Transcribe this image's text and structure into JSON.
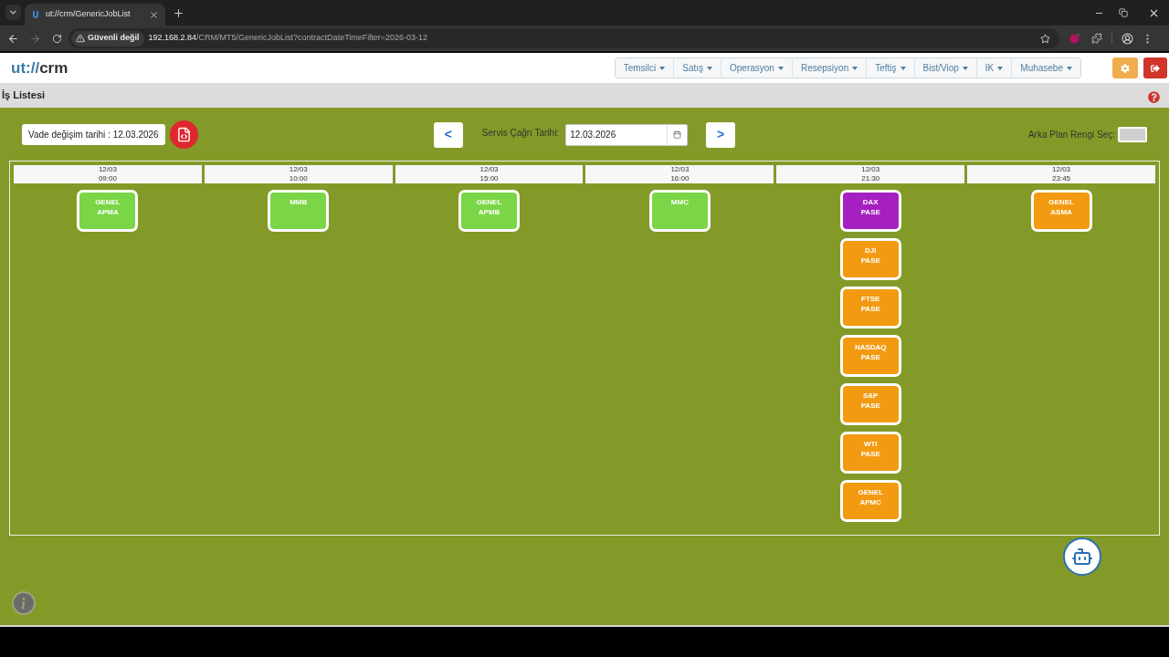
{
  "browser": {
    "tab": {
      "title": "ut://crm/GenericJobList"
    },
    "forward_button": {
      "disabled": true
    },
    "address_bar": {
      "security_label": "Güvenli değil",
      "url_host": "192.168.2.84",
      "url_path": "/CRM/MT5/GenericJobList?contractDateTimeFilter=2026-03-12"
    }
  },
  "header": {
    "logo": {
      "scheme": "ut://",
      "name": "crm"
    },
    "menu": [
      "Temsilci",
      "Satış",
      "Operasyon",
      "Resepsiyon",
      "Teftiş",
      "Bist/Viop",
      "IK",
      "Muhasebe"
    ]
  },
  "page_title": "İş Listesi",
  "toolbar": {
    "expiry_date_label": "Vade değişim tarihi : 12.03.2026",
    "prev_button": "<",
    "service_date": {
      "label": "Servis Çağrı Tarihi:",
      "value": "12.03.2026"
    },
    "next_button": ">",
    "background_picker": {
      "label": "Arka Plan Rengi Seç:"
    }
  },
  "columns": [
    {
      "date": "12/03",
      "time": "09:00",
      "jobs": [
        {
          "lines": [
            "GENEL",
            "APMA"
          ],
          "color": "#7ad646"
        }
      ]
    },
    {
      "date": "12/03",
      "time": "10:00",
      "jobs": [
        {
          "lines": [
            "MMB"
          ],
          "color": "#7ad646"
        }
      ]
    },
    {
      "date": "12/03",
      "time": "15:00",
      "jobs": [
        {
          "lines": [
            "GENEL",
            "APMB"
          ],
          "color": "#7ad646"
        }
      ]
    },
    {
      "date": "12/03",
      "time": "16:00",
      "jobs": [
        {
          "lines": [
            "MMC"
          ],
          "color": "#7ad646"
        }
      ]
    },
    {
      "date": "12/03",
      "time": "21:30",
      "jobs": [
        {
          "lines": [
            "DAX",
            "PASE"
          ],
          "color": "#a61fc0"
        },
        {
          "lines": [
            "DJI",
            "PASE"
          ],
          "color": "#f29b11"
        },
        {
          "lines": [
            "FTSE",
            "PASE"
          ],
          "color": "#f29b11"
        },
        {
          "lines": [
            "NASDAQ",
            "PASE"
          ],
          "color": "#f29b11"
        },
        {
          "lines": [
            "S&P",
            "PASE"
          ],
          "color": "#f29b11"
        },
        {
          "lines": [
            "WTI",
            "PASE"
          ],
          "color": "#f29b11"
        },
        {
          "lines": [
            "GENEL",
            "APMC"
          ],
          "color": "#f29b11"
        }
      ]
    },
    {
      "date": "12/03",
      "time": "23:45",
      "jobs": [
        {
          "lines": [
            "GENEL",
            "ASMA"
          ],
          "color": "#f29b11"
        }
      ]
    }
  ]
}
